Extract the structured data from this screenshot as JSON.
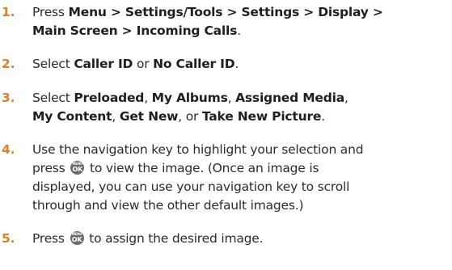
{
  "steps": [
    {
      "number": "1.",
      "lines": [
        [
          {
            "t": "Press ",
            "b": false
          },
          {
            "t": "Menu > Settings/Tools > Settings > Display >",
            "b": true
          }
        ],
        [
          {
            "t": "Main Screen > Incoming Calls",
            "b": true
          },
          {
            "t": ".",
            "b": false
          }
        ]
      ]
    },
    {
      "number": "2.",
      "lines": [
        [
          {
            "t": "Select ",
            "b": false
          },
          {
            "t": "Caller ID",
            "b": true
          },
          {
            "t": " or ",
            "b": false
          },
          {
            "t": "No Caller ID",
            "b": true
          },
          {
            "t": ".",
            "b": false
          }
        ]
      ]
    },
    {
      "number": "3.",
      "lines": [
        [
          {
            "t": "Select ",
            "b": false
          },
          {
            "t": "Preloaded",
            "b": true
          },
          {
            "t": ", ",
            "b": false
          },
          {
            "t": "My Albums",
            "b": true
          },
          {
            "t": ", ",
            "b": false
          },
          {
            "t": "Assigned Media",
            "b": true
          },
          {
            "t": ",",
            "b": false
          }
        ],
        [
          {
            "t": "My Content",
            "b": true
          },
          {
            "t": ", ",
            "b": false
          },
          {
            "t": "Get New",
            "b": true
          },
          {
            "t": ", or ",
            "b": false
          },
          {
            "t": "Take New Picture",
            "b": true
          },
          {
            "t": ".",
            "b": false
          }
        ]
      ]
    },
    {
      "number": "4.",
      "lines": [
        [
          {
            "t": "Use the navigation key to highlight your selection and",
            "b": false
          }
        ],
        [
          {
            "t": "press ",
            "b": false
          },
          {
            "icon": "menu-ok-icon"
          },
          {
            "t": " to view the image. (Once an image is",
            "b": false
          }
        ],
        [
          {
            "t": "displayed, you can use your navigation key to scroll",
            "b": false
          }
        ],
        [
          {
            "t": "through and view the other default images.)",
            "b": false
          }
        ]
      ]
    },
    {
      "number": "5.",
      "lines": [
        [
          {
            "t": "Press ",
            "b": false
          },
          {
            "icon": "menu-ok-icon"
          },
          {
            "t": " to assign the desired image.",
            "b": false
          }
        ]
      ]
    }
  ],
  "icon_labels": {
    "menu_ok_top": "MENU",
    "menu_ok_bottom": "OK"
  },
  "colors": {
    "step_number": "#d9822b",
    "body_text": "#2b2b2b",
    "icon_fill": "#6a6a6a"
  }
}
